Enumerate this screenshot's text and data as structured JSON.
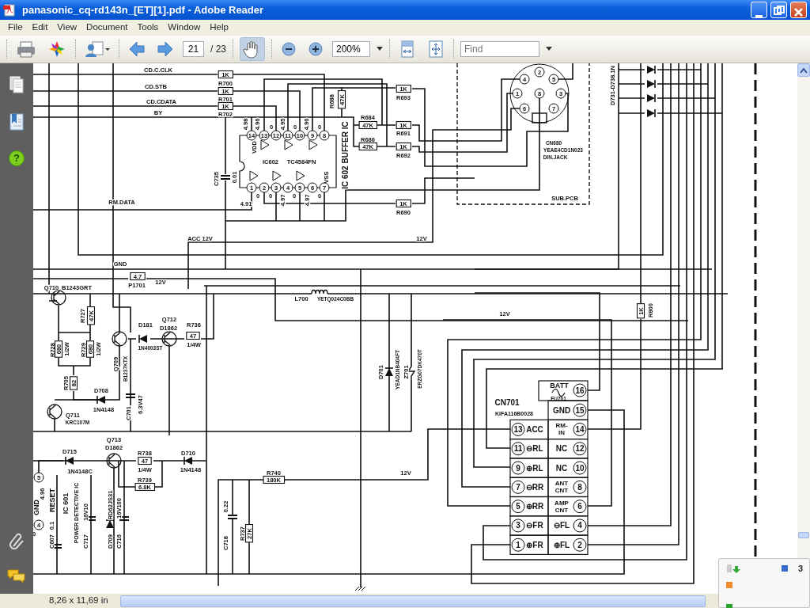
{
  "window": {
    "title": "panasonic_cq-rd143n_[ET][1].pdf - Adobe Reader"
  },
  "menu": [
    "File",
    "Edit",
    "View",
    "Document",
    "Tools",
    "Window",
    "Help"
  ],
  "toolbar": {
    "page": "21",
    "page_total": "/ 23",
    "zoom": "200%",
    "find_placeholder": "Find",
    "hand_tool_selected": true
  },
  "nav_panel": {
    "help_glyph": "?"
  },
  "schematic": {
    "labels": [
      {
        "text": "CD.C.CLK",
        "kind": "label"
      },
      {
        "text": "1K",
        "kind": "resistor"
      },
      {
        "text": "R700",
        "kind": "label"
      },
      {
        "text": "CD.STB",
        "kind": "label"
      },
      {
        "text": "1K",
        "kind": "resistor"
      },
      {
        "text": "R701",
        "kind": "label"
      },
      {
        "text": "CD.CDATA",
        "kind": "label"
      },
      {
        "text": "1K",
        "kind": "resistor"
      },
      {
        "text": "R702",
        "kind": "label"
      },
      {
        "text": "BY",
        "kind": "label"
      },
      {
        "text": "14",
        "kind": "pin"
      },
      {
        "text": "13",
        "kind": "pin"
      },
      {
        "text": "12",
        "kind": "pin"
      },
      {
        "text": "11",
        "kind": "pin"
      },
      {
        "text": "10",
        "kind": "pin"
      },
      {
        "text": "9",
        "kind": "pin"
      },
      {
        "text": "8",
        "kind": "pin"
      },
      {
        "text": "4.98",
        "kind": "vlabel"
      },
      {
        "text": "4.96",
        "kind": "vlabel"
      },
      {
        "text": "0",
        "kind": "label"
      },
      {
        "text": "4.95",
        "kind": "vlabel"
      },
      {
        "text": "0",
        "kind": "label"
      },
      {
        "text": "4.96",
        "kind": "vlabel"
      },
      {
        "text": "0",
        "kind": "label"
      },
      {
        "text": "VDD",
        "kind": "vlabel"
      },
      {
        "text": "IC602",
        "kind": "label"
      },
      {
        "text": "TC4584FN",
        "kind": "label"
      },
      {
        "text": "VSS",
        "kind": "vlabel"
      },
      {
        "text": "IC 602 BUFFER IC",
        "kind": "vlabel"
      },
      {
        "text": "1",
        "kind": "pin"
      },
      {
        "text": "2",
        "kind": "pin"
      },
      {
        "text": "3",
        "kind": "pin"
      },
      {
        "text": "4",
        "kind": "pin"
      },
      {
        "text": "5",
        "kind": "pin"
      },
      {
        "text": "6",
        "kind": "pin"
      },
      {
        "text": "7",
        "kind": "pin"
      },
      {
        "text": "4.91",
        "kind": "label"
      },
      {
        "text": "0",
        "kind": "label"
      },
      {
        "text": "0",
        "kind": "label"
      },
      {
        "text": "4.97",
        "kind": "vlabel"
      },
      {
        "text": "0",
        "kind": "label"
      },
      {
        "text": "4.97",
        "kind": "vlabel"
      },
      {
        "text": "0",
        "kind": "label"
      },
      {
        "text": "C735",
        "kind": "vlabel"
      },
      {
        "text": "0.01",
        "kind": "vlabel"
      },
      {
        "text": "R688",
        "kind": "vlabel"
      },
      {
        "text": "47K",
        "kind": "vresistor"
      },
      {
        "text": "R684",
        "kind": "label"
      },
      {
        "text": "47K",
        "kind": "resistor"
      },
      {
        "text": "R686",
        "kind": "label"
      },
      {
        "text": "47K",
        "kind": "resistor"
      },
      {
        "text": "1K",
        "kind": "resistor"
      },
      {
        "text": "R693",
        "kind": "label"
      },
      {
        "text": "1K",
        "kind": "resistor"
      },
      {
        "text": "R691",
        "kind": "label"
      },
      {
        "text": "1K",
        "kind": "resistor"
      },
      {
        "text": "R692",
        "kind": "label"
      },
      {
        "text": "1K",
        "kind": "resistor"
      },
      {
        "text": "R690",
        "kind": "label"
      },
      {
        "text": "RM.DATA",
        "kind": "label"
      },
      {
        "text": "ACC 12V",
        "kind": "label"
      },
      {
        "text": "12V",
        "kind": "label"
      },
      {
        "text": "GND",
        "kind": "label"
      },
      {
        "text": "2",
        "kind": "pin"
      },
      {
        "text": "4",
        "kind": "pin"
      },
      {
        "text": "5",
        "kind": "pin"
      },
      {
        "text": "1",
        "kind": "pin"
      },
      {
        "text": "8",
        "kind": "pin"
      },
      {
        "text": "3",
        "kind": "pin"
      },
      {
        "text": "6",
        "kind": "pin"
      },
      {
        "text": "7",
        "kind": "pin"
      },
      {
        "text": "CN680",
        "kind": "label"
      },
      {
        "text": "YEAE4CD1N023",
        "kind": "label"
      },
      {
        "text": "DIN.JACK",
        "kind": "label"
      },
      {
        "text": "SUB.PCB",
        "kind": "label"
      },
      {
        "text": "D731-D738.1N",
        "kind": "vlabel"
      },
      {
        "text": "4.7",
        "kind": "resistor"
      },
      {
        "text": "P1701",
        "kind": "label"
      },
      {
        "text": "12V",
        "kind": "label"
      },
      {
        "text": "Q710",
        "kind": "label"
      },
      {
        "text": "B1243GRT",
        "kind": "label"
      },
      {
        "text": "R727",
        "kind": "vlabel"
      },
      {
        "text": "47K",
        "kind": "vresistor"
      },
      {
        "text": "R728",
        "kind": "vlabel"
      },
      {
        "text": "680",
        "kind": "vresistor"
      },
      {
        "text": "1/2W",
        "kind": "vlabel"
      },
      {
        "text": "R729",
        "kind": "vlabel"
      },
      {
        "text": "680",
        "kind": "vresistor"
      },
      {
        "text": "1/2W",
        "kind": "vlabel"
      },
      {
        "text": "R705",
        "kind": "vlabel"
      },
      {
        "text": "82",
        "kind": "vresistor"
      },
      {
        "text": "D708",
        "kind": "label"
      },
      {
        "text": "1N4148",
        "kind": "label"
      },
      {
        "text": "Q711",
        "kind": "label"
      },
      {
        "text": "KRC107M",
        "kind": "label"
      },
      {
        "text": "Q709",
        "kind": "vlabel"
      },
      {
        "text": "B1237KTX",
        "kind": "vlabel"
      },
      {
        "text": "C701",
        "kind": "vlabel"
      },
      {
        "text": "6.3V47",
        "kind": "vlabel"
      },
      {
        "text": "D181",
        "kind": "label"
      },
      {
        "text": "1N4003ST",
        "kind": "label"
      },
      {
        "text": "Q712",
        "kind": "label"
      },
      {
        "text": "D1862",
        "kind": "label"
      },
      {
        "text": "R736",
        "kind": "label"
      },
      {
        "text": "47",
        "kind": "resistor"
      },
      {
        "text": "1/4W",
        "kind": "label"
      },
      {
        "text": "L700",
        "kind": "label"
      },
      {
        "text": "YETQ024C0BB",
        "kind": "label"
      },
      {
        "text": "D701",
        "kind": "vlabel"
      },
      {
        "text": "YEAD1NB404FT",
        "kind": "vlabel"
      },
      {
        "text": "Z701",
        "kind": "vlabel"
      },
      {
        "text": "ERZG07DK470T",
        "kind": "vlabel"
      },
      {
        "text": "D715",
        "kind": "label"
      },
      {
        "text": "1N4148C",
        "kind": "label"
      },
      {
        "text": "Q713",
        "kind": "label"
      },
      {
        "text": "D1862",
        "kind": "label"
      },
      {
        "text": "R738",
        "kind": "label"
      },
      {
        "text": "47",
        "kind": "resistor"
      },
      {
        "text": "1/4W",
        "kind": "label"
      },
      {
        "text": "R739",
        "kind": "label"
      },
      {
        "text": "6.8K",
        "kind": "resistor"
      },
      {
        "text": "D710",
        "kind": "label"
      },
      {
        "text": "1N4148",
        "kind": "label"
      },
      {
        "text": "R740",
        "kind": "label"
      },
      {
        "text": "180K",
        "kind": "resistor"
      },
      {
        "text": "12V",
        "kind": "label"
      },
      {
        "text": "5",
        "kind": "pin"
      },
      {
        "text": "4.96",
        "kind": "vlabel"
      },
      {
        "text": "RESET",
        "kind": "vlabel"
      },
      {
        "text": "GND",
        "kind": "vlabel"
      },
      {
        "text": "4",
        "kind": "pin"
      },
      {
        "text": "0",
        "kind": "label"
      },
      {
        "text": "IC 601",
        "kind": "vlabel"
      },
      {
        "text": "POWER DETECTIVE IC",
        "kind": "vlabel"
      },
      {
        "text": "0.1",
        "kind": "vlabel"
      },
      {
        "text": "C607",
        "kind": "vlabel"
      },
      {
        "text": "16V10",
        "kind": "vlabel"
      },
      {
        "text": "C717",
        "kind": "vlabel"
      },
      {
        "text": "RD62JS31",
        "kind": "vlabel"
      },
      {
        "text": "D709",
        "kind": "vlabel"
      },
      {
        "text": "16V100",
        "kind": "vlabel"
      },
      {
        "text": "C716",
        "kind": "vlabel"
      },
      {
        "text": "0.22",
        "kind": "vlabel"
      },
      {
        "text": "C718",
        "kind": "vlabel"
      },
      {
        "text": "R737",
        "kind": "vlabel"
      },
      {
        "text": "27K",
        "kind": "vresistor"
      },
      {
        "text": "1K",
        "kind": "vresistor"
      },
      {
        "text": "R800",
        "kind": "vlabel"
      },
      {
        "text": "12V",
        "kind": "label"
      },
      {
        "text": "CN701",
        "kind": "label"
      },
      {
        "text": "KIFA116B0028",
        "kind": "label"
      }
    ],
    "cn701": {
      "batt": {
        "label": "BATT",
        "fuse": "FU701",
        "pin": "16"
      },
      "rows": [
        {
          "right": {
            "lines": [
              "GND"
            ],
            "pin": "15"
          }
        },
        {
          "left": {
            "pin": "13",
            "lines": [
              "ACC"
            ]
          },
          "right": {
            "lines": [
              "RM-",
              "IN"
            ],
            "pin": "14"
          }
        },
        {
          "left": {
            "pin": "11",
            "lines": [
              "⊖RL"
            ]
          },
          "right": {
            "lines": [
              "NC"
            ],
            "pin": "12"
          }
        },
        {
          "left": {
            "pin": "9",
            "lines": [
              "⊕RL"
            ]
          },
          "right": {
            "lines": [
              "NC"
            ],
            "pin": "10"
          }
        },
        {
          "left": {
            "pin": "7",
            "lines": [
              "⊖RR"
            ]
          },
          "right": {
            "lines": [
              "ANT",
              "CNT"
            ],
            "pin": "8"
          }
        },
        {
          "left": {
            "pin": "5",
            "lines": [
              "⊕RR"
            ]
          },
          "right": {
            "lines": [
              "AMP",
              "CNT"
            ],
            "pin": "6"
          }
        },
        {
          "left": {
            "pin": "3",
            "lines": [
              "⊖FR"
            ]
          },
          "right": {
            "lines": [
              "⊖FL"
            ],
            "pin": "4"
          }
        },
        {
          "left": {
            "pin": "1",
            "lines": [
              "⊕FR"
            ]
          },
          "right": {
            "lines": [
              "⊕FL"
            ],
            "pin": "2"
          }
        }
      ]
    }
  },
  "status_bar": {
    "page_size": "8,26 x 11,69 in"
  },
  "pan_panel": {
    "page_number": "3"
  }
}
